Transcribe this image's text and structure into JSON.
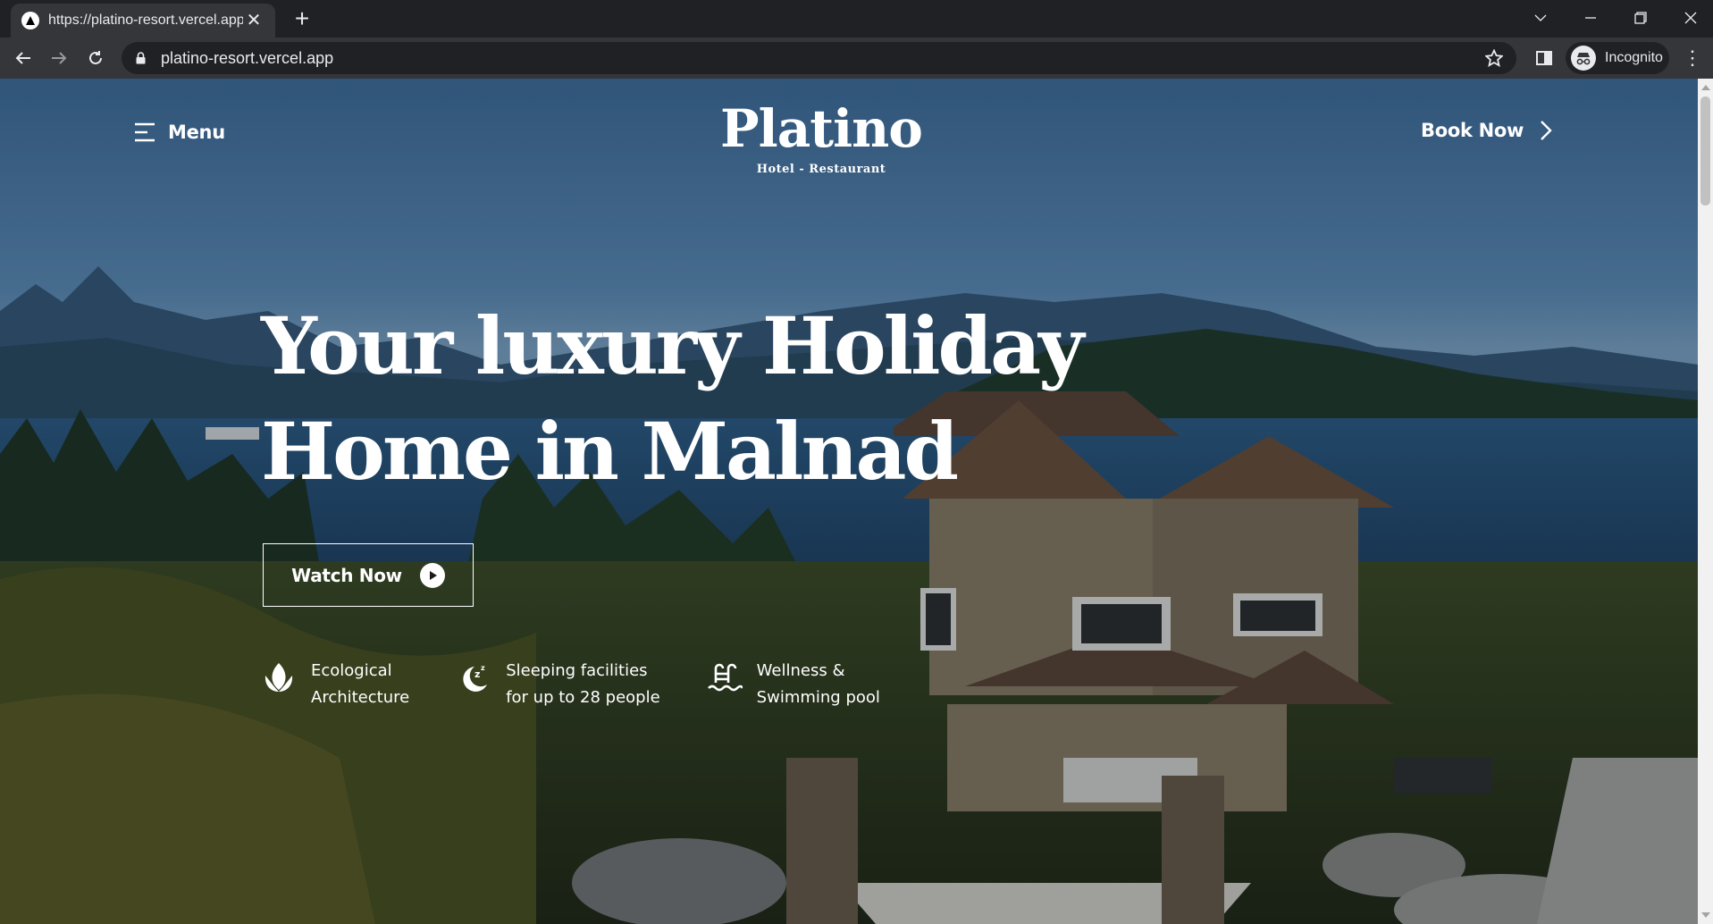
{
  "browser": {
    "tab_title": "https://platino-resort.vercel.app",
    "url": "platino-resort.vercel.app",
    "profile_label": "Incognito"
  },
  "nav": {
    "menu_label": "Menu",
    "brand_name": "Platino",
    "brand_tagline": "Hotel - Restaurant",
    "book_label": "Book Now"
  },
  "hero": {
    "headline_line1": "Your luxury Holiday",
    "headline_line2": "Home in Malnad",
    "watch_label": "Watch Now"
  },
  "features": [
    {
      "icon": "leaf-icon",
      "line1": "Ecological",
      "line2": "Architecture"
    },
    {
      "icon": "moon-sleep-icon",
      "line1": "Sleeping facilities",
      "line2": "for up to 28 people"
    },
    {
      "icon": "pool-ladder-icon",
      "line1": "Wellness &",
      "line2": "Swimming pool"
    }
  ],
  "colors": {
    "chrome_dark": "#202124",
    "chrome_toolbar": "#35363a",
    "text_light": "#ffffff"
  }
}
